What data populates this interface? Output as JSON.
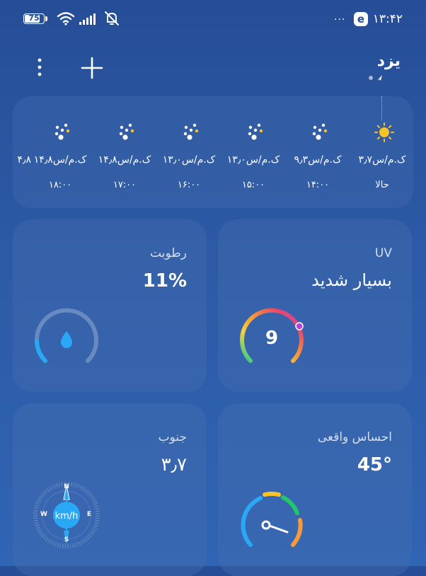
{
  "status_bar": {
    "battery": "75",
    "battery_level": 0.75,
    "time": "۱۳:۴۲",
    "overflow_dots": "···",
    "app_badge": "e"
  },
  "header": {
    "city": "یزد",
    "menu_icon": "more-vert-icon",
    "add_icon": "plus-icon",
    "location_icon": "location-arrow-icon"
  },
  "hourly": [
    {
      "time": "حالا",
      "wind": "۳٫۷ک.م/س",
      "icon": "sun-icon"
    },
    {
      "time": "۱۴:۰۰",
      "wind": "۹٫۳ک.م/س",
      "icon": "night-cloudy-icon"
    },
    {
      "time": "۱۵:۰۰",
      "wind": "۱۳٫۰ک.م/س",
      "icon": "night-cloudy-icon"
    },
    {
      "time": "۱۶:۰۰",
      "wind": "۱۳٫۰ک.م/س",
      "icon": "night-cloudy-icon"
    },
    {
      "time": "۱۷:۰۰",
      "wind": "۱۴٫۸ک.م/س",
      "icon": "night-cloudy-icon"
    },
    {
      "time": "۱۸:۰۰",
      "wind": "۱۴٫۸ک.م/س",
      "icon": "night-cloudy-icon"
    },
    {
      "time": "",
      "wind": "۴٫۸",
      "icon": ""
    }
  ],
  "uv": {
    "label": "UV",
    "value": "بسیار شدید",
    "index": "9"
  },
  "humidity": {
    "label": "رطوبت",
    "value": "11%",
    "level": 0.11,
    "icon": "water-drop-icon"
  },
  "feels_like": {
    "label": "احساس واقعی",
    "value": "45°"
  },
  "wind": {
    "label": "جنوب",
    "value": "۳٫۷",
    "unit": "km/h",
    "compass": {
      "n": "N",
      "s": "S",
      "e": "E",
      "w": "W"
    }
  },
  "colors": {
    "accent_blue": "#2aa8f5",
    "background": "#2c5aa6"
  }
}
